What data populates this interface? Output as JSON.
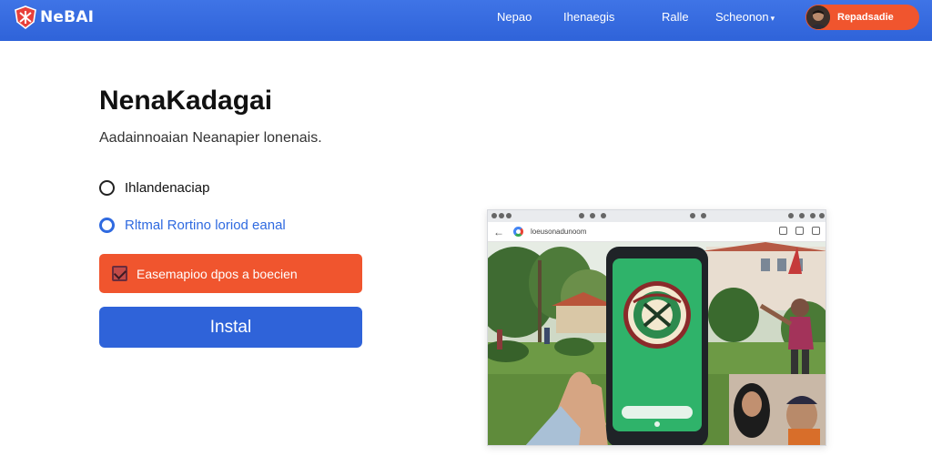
{
  "app": {
    "logo_text": "NeBAI"
  },
  "nav": {
    "links": [
      "Nepao",
      "Ihenaegis",
      "Ralle",
      "Scheonon"
    ],
    "dropdown_caret": "▾",
    "user_name": "Repadsadie"
  },
  "main": {
    "title": "NenaKadagai",
    "subtitle": "Aadainnoaian Neanapier lonenais."
  },
  "options": {
    "radio_1_label": "Ihlandenaciap",
    "radio_2_label": "Rltmal Rortino loriod eanal",
    "checkbox_label": "Easemapioo dpos a boecien",
    "checkbox_checked": true
  },
  "actions": {
    "install_label": "Instal"
  },
  "preview": {
    "url_text": "loeusonadunoom",
    "back_icon": "←"
  },
  "colors": {
    "nav_blue": "#2f63d9",
    "accent_orange": "#f0552e",
    "radio_blue": "#2f6ae0",
    "phone_screen_green": "#2fb36a"
  }
}
